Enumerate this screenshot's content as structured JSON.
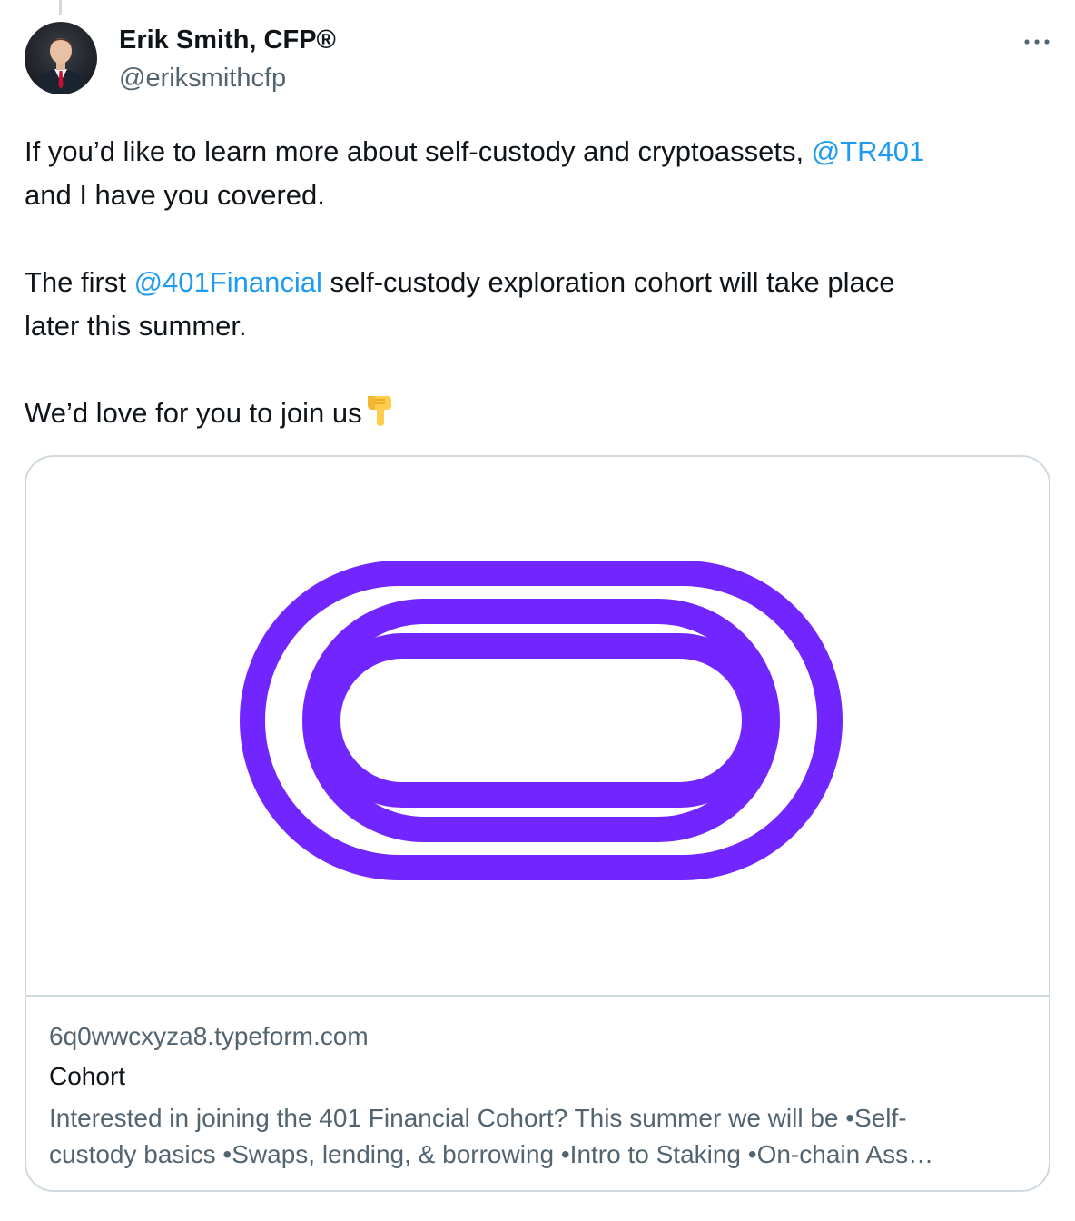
{
  "author": {
    "name": "Erik Smith, CFP®",
    "handle": "@eriksmithcfp"
  },
  "more_icon": "more-horizontal-icon",
  "tweet": {
    "p1_text": "If you’d like to learn more about self-custody and cryptoassets, ",
    "p1_mention": "@TR401",
    "p1_line2": "and I have you covered.",
    "p2_pre": "The first ",
    "p2_mention": "@401Financial",
    "p2_post": " self-custody exploration cohort will take place",
    "p2_line2": "later this summer.",
    "p3_text": "We’d love for you to join us",
    "p3_emoji": "pointing-down-hand-icon"
  },
  "card": {
    "domain": "6q0wwcxyza8.typeform.com",
    "title": "Cohort",
    "description_line1": "Interested in joining the 401 Financial Cohort? This summer we will be •Self-",
    "description_line2": "custody basics •Swaps, lending, & borrowing •Intro to Staking •On-chain Ass…",
    "logo_color": "#7226ff"
  },
  "colors": {
    "link": "#1d9bf0",
    "text": "#0f1419",
    "secondary": "#536471",
    "border": "#cfd9de"
  }
}
